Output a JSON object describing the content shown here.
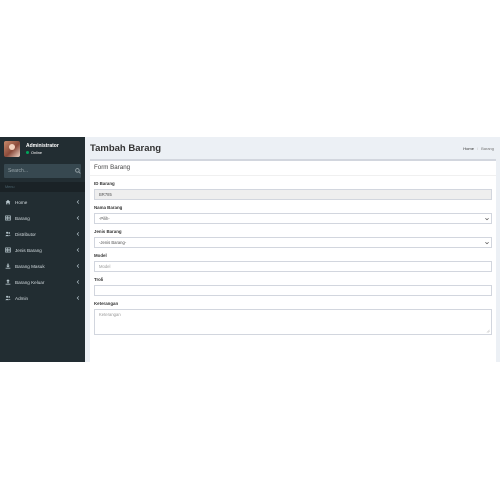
{
  "sidebar": {
    "user_name": "Administrator",
    "user_status": "Online",
    "search_placeholder": "Search...",
    "menu_header": "Menu",
    "items": [
      {
        "label": "Home",
        "icon": "home-icon"
      },
      {
        "label": "Barang",
        "icon": "table-icon"
      },
      {
        "label": "Distributor",
        "icon": "users-icon"
      },
      {
        "label": "Jenis Barang",
        "icon": "table-icon"
      },
      {
        "label": "Barang Masuk",
        "icon": "download-icon"
      },
      {
        "label": "Barang Keluar",
        "icon": "upload-icon"
      },
      {
        "label": "Admin",
        "icon": "users-icon"
      }
    ]
  },
  "header": {
    "title": "Tambah Barang",
    "breadcrumb": [
      "Home",
      "Barang"
    ]
  },
  "form": {
    "title": "Form Barang",
    "id_label": "ID Barang",
    "id_value": "BR785",
    "nama_label": "Nama Barang",
    "nama_selected": "-Pilih-",
    "jenis_label": "Jenis Barang",
    "jenis_selected": "-Jenis Barang-",
    "model_label": "Model",
    "model_placeholder": "Model",
    "troli_label": "Troli",
    "troli_value": "",
    "keterangan_label": "Keterangan",
    "keterangan_placeholder": "Keterangan"
  },
  "colors": {
    "sidebar_bg": "#222d32",
    "content_bg": "#ecf0f5",
    "online": "#00a65a"
  }
}
